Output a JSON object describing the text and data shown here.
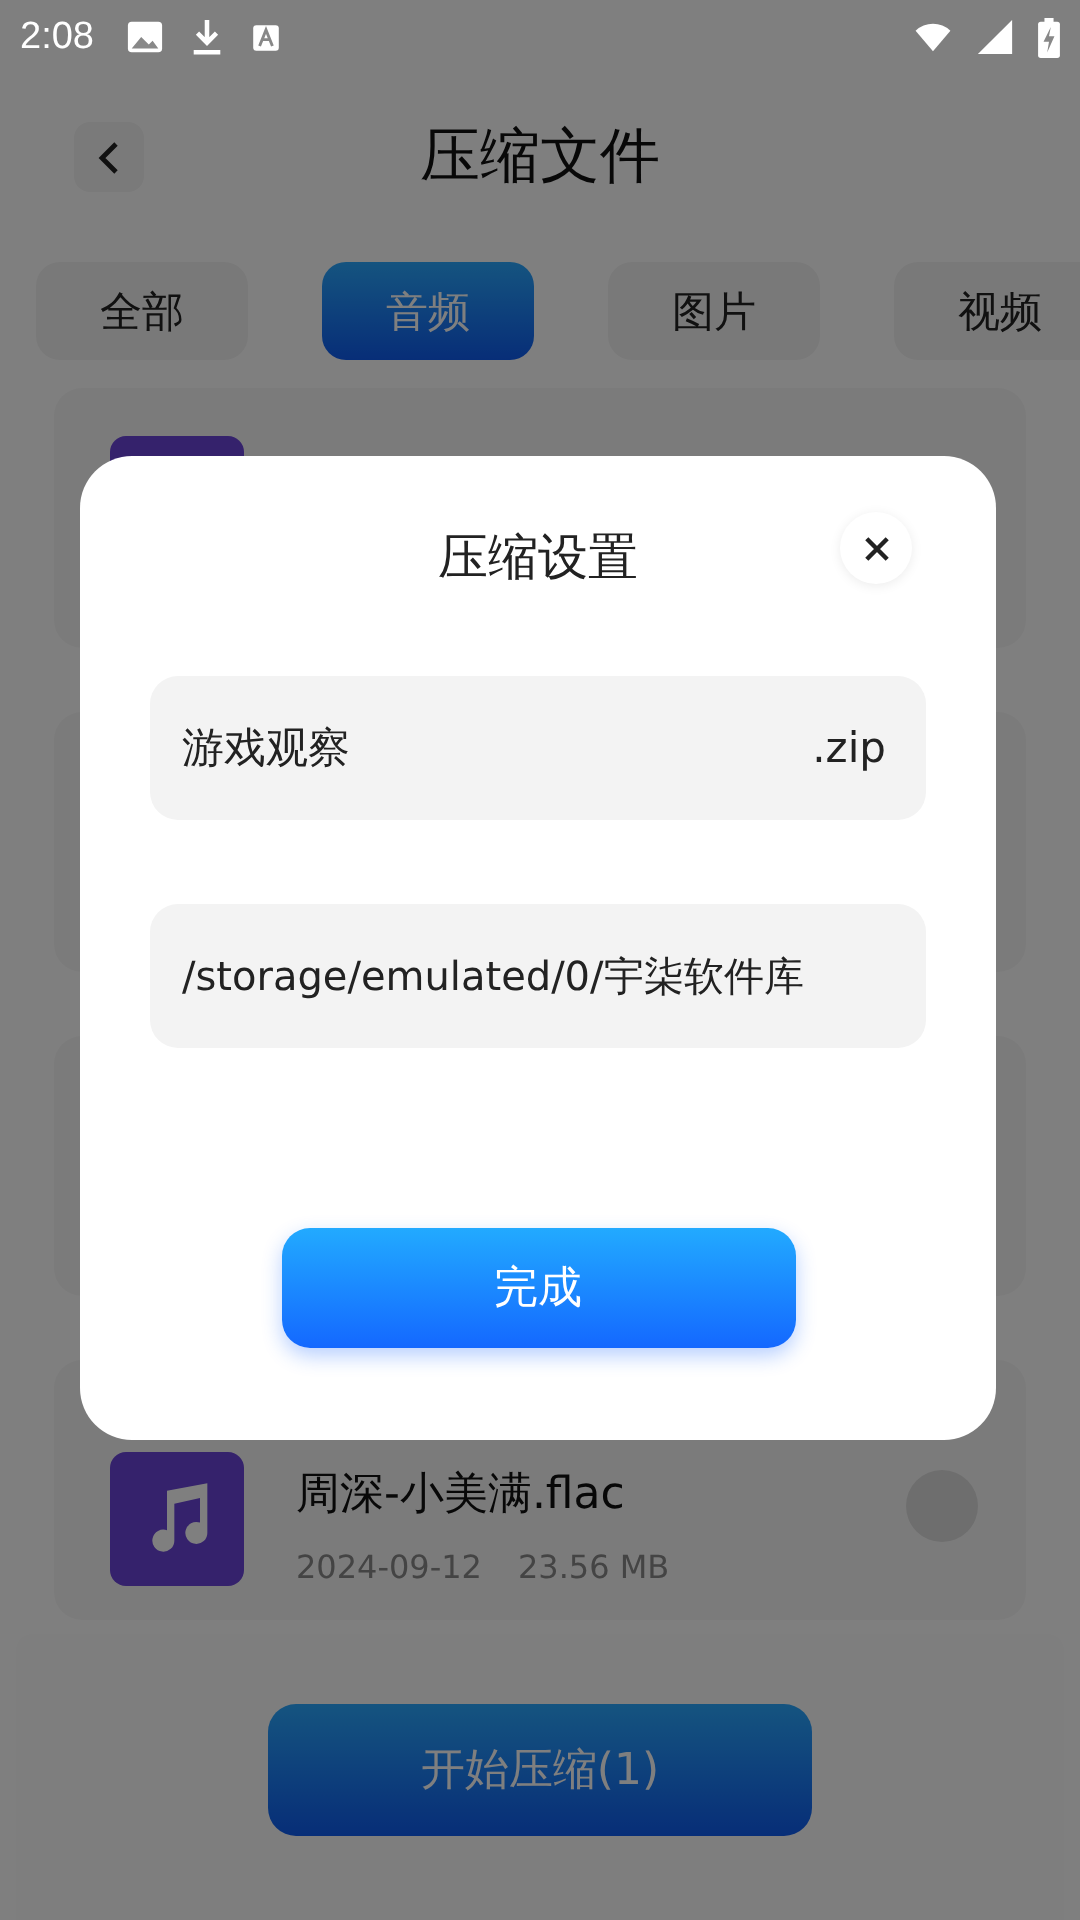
{
  "status_bar": {
    "time": "2:08"
  },
  "header": {
    "title": "压缩文件"
  },
  "tabs": [
    {
      "label": "全部",
      "selected": false
    },
    {
      "label": "音频",
      "selected": true
    },
    {
      "label": "图片",
      "selected": false
    },
    {
      "label": "视频",
      "selected": false
    }
  ],
  "files": [
    {
      "kind": "covered"
    },
    {
      "kind": "blank"
    },
    {
      "kind": "blank"
    },
    {
      "kind": "audio",
      "name": "周深-小美满.flac",
      "date": "2024-09-12",
      "size": "23.56 MB",
      "selected": false
    }
  ],
  "start_button": "开始压缩(1)",
  "dialog": {
    "title": "压缩设置",
    "file_name": "游戏观察",
    "extension": ".zip",
    "path": "/storage/emulated/0/宇柒软件库",
    "confirm": "完成"
  }
}
